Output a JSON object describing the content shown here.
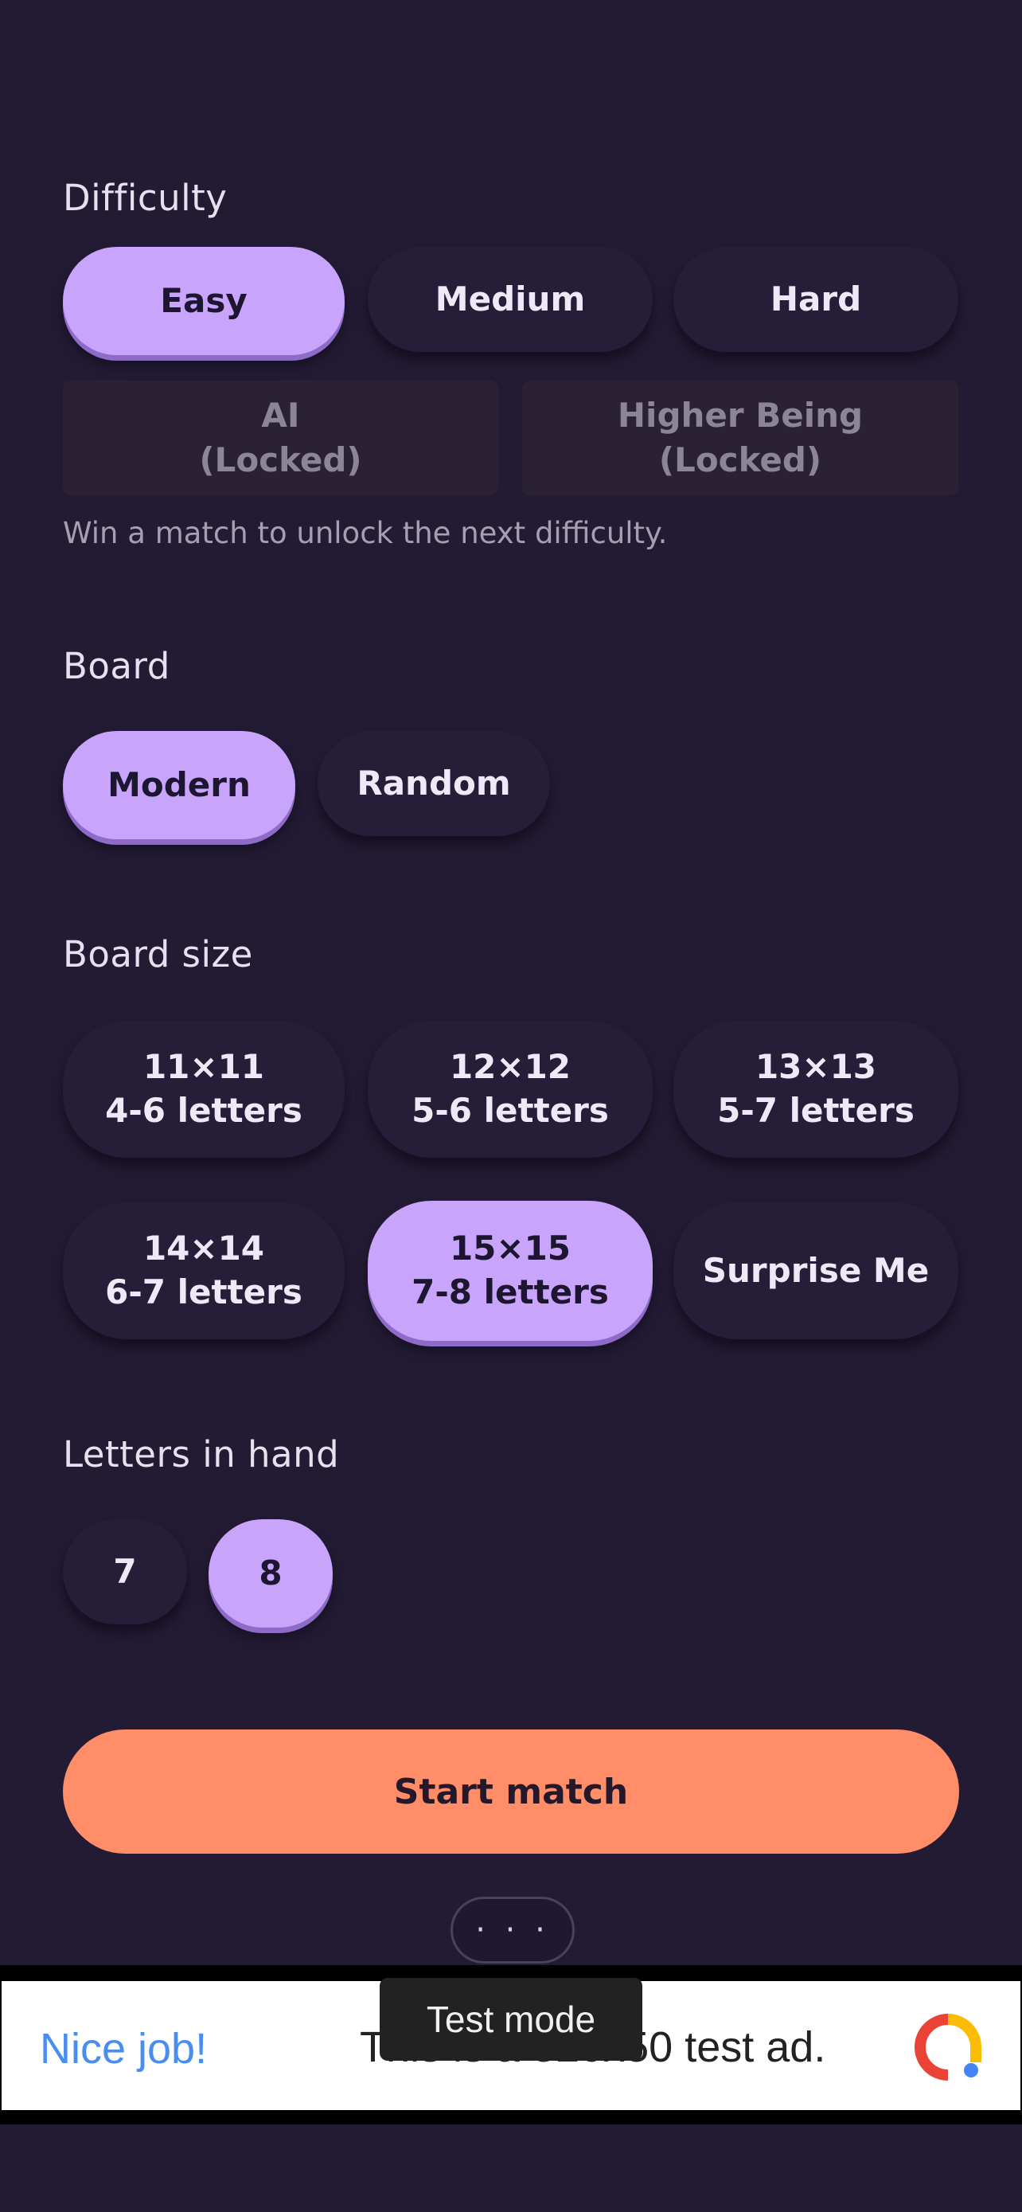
{
  "difficulty": {
    "title": "Difficulty",
    "options": [
      "Easy",
      "Medium",
      "Hard"
    ],
    "locked": [
      "AI\n(Locked)",
      "Higher Being\n(Locked)"
    ],
    "hint": "Win a match to unlock the next difficulty.",
    "selected": "Easy"
  },
  "board": {
    "title": "Board",
    "options": [
      "Modern",
      "Random"
    ],
    "selected": "Modern"
  },
  "board_size": {
    "title": "Board size",
    "options": [
      "11×11\n4-6 letters",
      "12×12\n5-6 letters",
      "13×13\n5-7 letters",
      "14×14\n6-7 letters",
      "15×15\n7-8 letters",
      "Surprise Me"
    ],
    "selected": "15×15\n7-8 letters"
  },
  "letters_in_hand": {
    "title": "Letters in hand",
    "options": [
      "7",
      "8"
    ],
    "selected": "8"
  },
  "start_label": "Start match",
  "more_label": "· · ·",
  "ad": {
    "headline": "Nice job!",
    "body": "This is a 320x50 test ad.",
    "toast": "Test mode"
  },
  "colors": {
    "background": "#231b34",
    "selected_pill": "#c9a4fb",
    "start_button": "#ff8d68"
  }
}
